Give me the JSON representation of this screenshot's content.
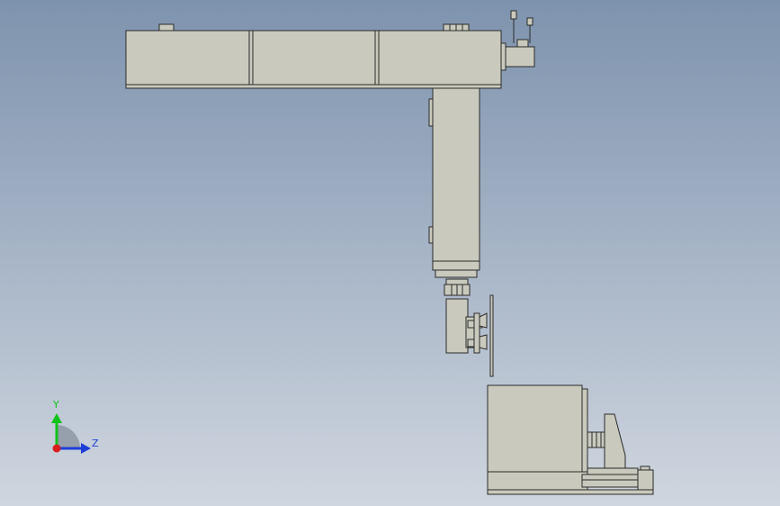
{
  "viewport": {
    "background_top": "#7e93ae",
    "background_bottom": "#cfd6df"
  },
  "model": {
    "body_color": "#c9cabd",
    "edge_color": "#2b2b2b",
    "shade_color": "#a9aa9e"
  },
  "triad": {
    "y_label": "Y",
    "z_label": "Z",
    "y_color": "#10c21a",
    "z_color": "#1d3fd6",
    "x_color": "#d81e1e",
    "plane_color": "#8e97a3"
  }
}
